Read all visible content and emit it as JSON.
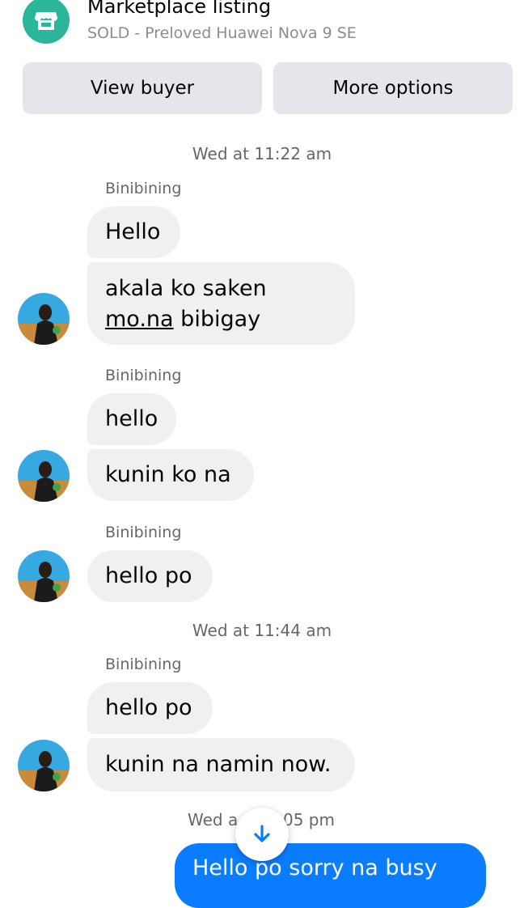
{
  "listing": {
    "title": "Marketplace listing",
    "subtitle": "SOLD - Preloved Huawei Nova 9 SE",
    "icon": "store-icon"
  },
  "actions": {
    "view_buyer": "View buyer",
    "more_options": "More options"
  },
  "timestamps": [
    "Wed at 11:22 am",
    "Wed at 11:44 am",
    "Wed a",
    "05 pm"
  ],
  "sender_name": "Binibining",
  "messages": {
    "m1": "Hello",
    "m2_line1": "akala ko saken",
    "m2_link": "mo.na",
    "m2_rest": " bibigay",
    "m3": "hello",
    "m4": "kunin ko na",
    "m5": "hello po",
    "m6": "hello po",
    "m7": "kunin na namin now.",
    "outgoing": "Hello po sorry na busy"
  },
  "colors": {
    "accent": "#0a7cff",
    "listing_icon_bg": "#2bb59a",
    "incoming_bubble": "#f0f0f0",
    "button_bg": "#e4e6eb"
  }
}
